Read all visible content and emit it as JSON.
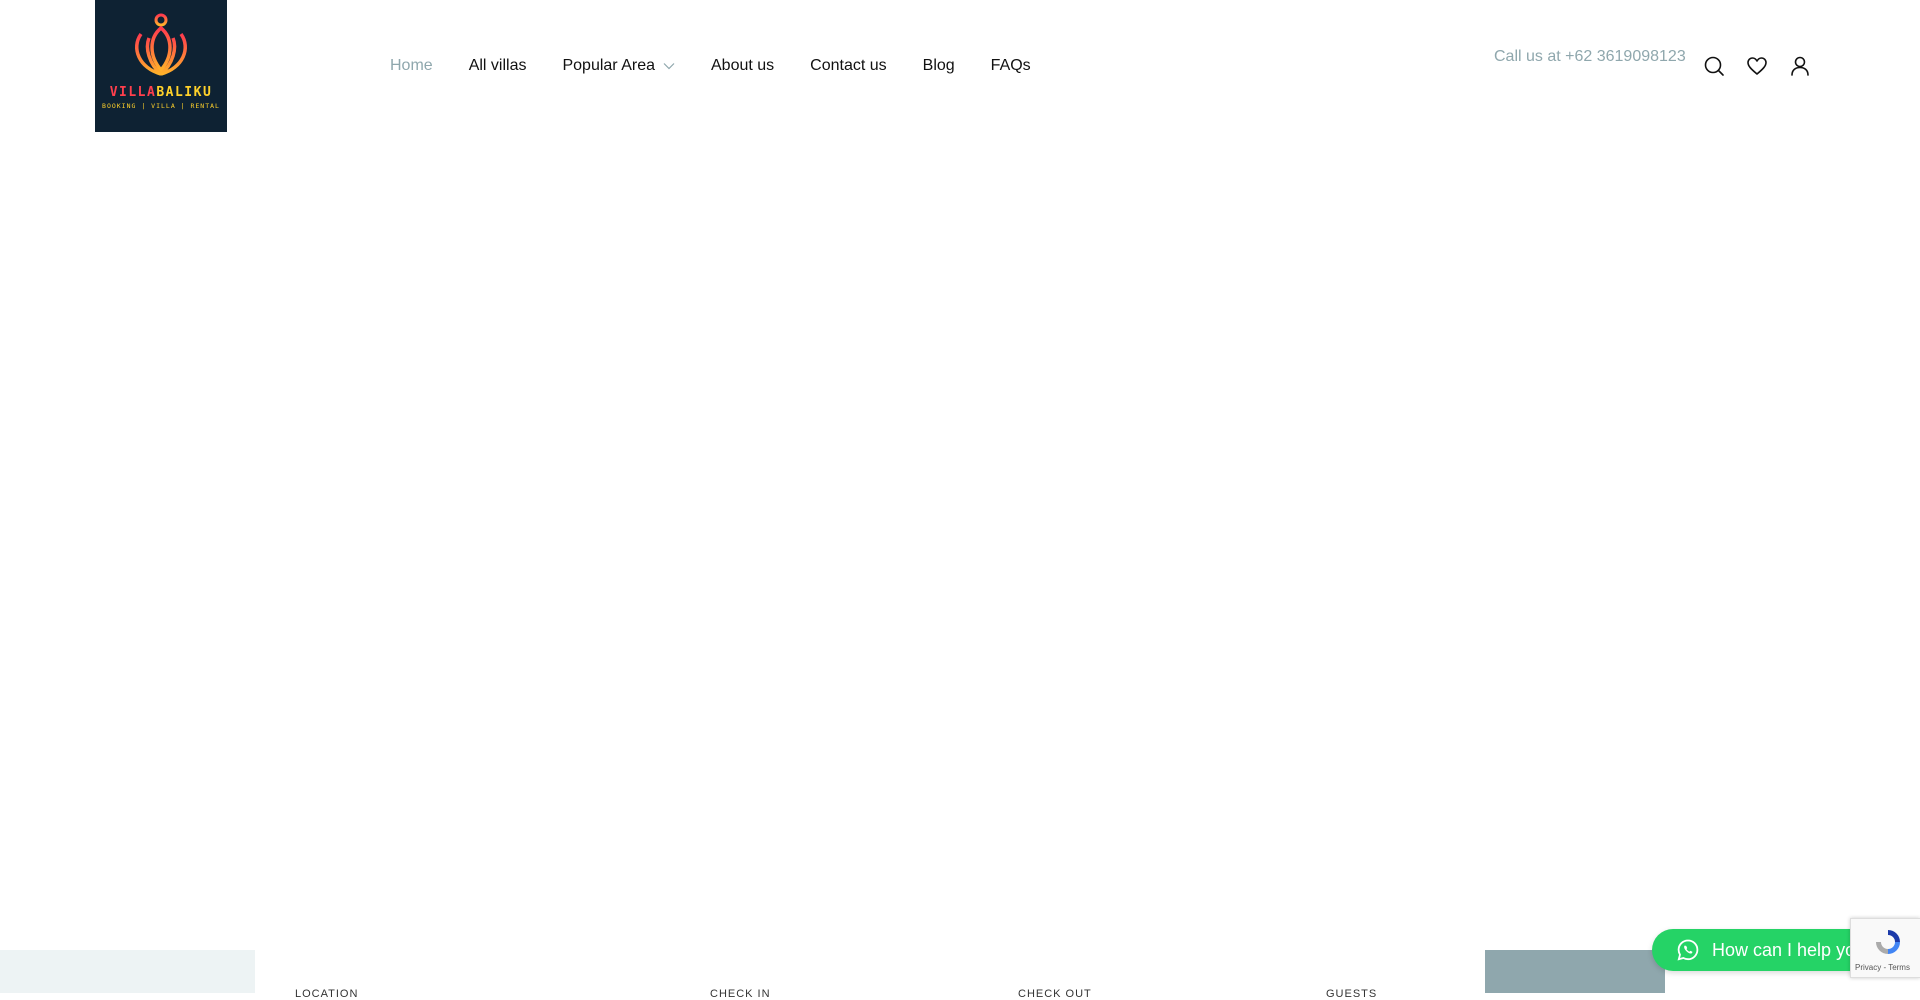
{
  "brand": {
    "name_part1": "VILLA",
    "name_part2": "BALIKU",
    "tagline": "BOOKING | VILLA | RENTAL"
  },
  "nav": {
    "items": [
      {
        "label": "Home",
        "active": true
      },
      {
        "label": "All villas"
      },
      {
        "label": "Popular Area",
        "has_dropdown": true
      },
      {
        "label": "About us"
      },
      {
        "label": "Contact us"
      },
      {
        "label": "Blog"
      },
      {
        "label": "FAQs"
      }
    ]
  },
  "contact": {
    "prefix": "Call us at ",
    "phone": "+62 3619098123"
  },
  "header_icons": [
    "search-icon",
    "heart-icon",
    "user-icon"
  ],
  "booking": {
    "fields": [
      "LOCATION",
      "CHECK IN",
      "CHECK OUT",
      "GUESTS"
    ]
  },
  "whatsapp": {
    "label": "How can I help you?"
  },
  "recaptcha": {
    "links": "Privacy - Terms"
  },
  "colors": {
    "accent": "#8fa7ad",
    "logo_bg": "#0e2233",
    "whatsapp": "#25d366",
    "booking_left_bg": "#edf3f4"
  }
}
